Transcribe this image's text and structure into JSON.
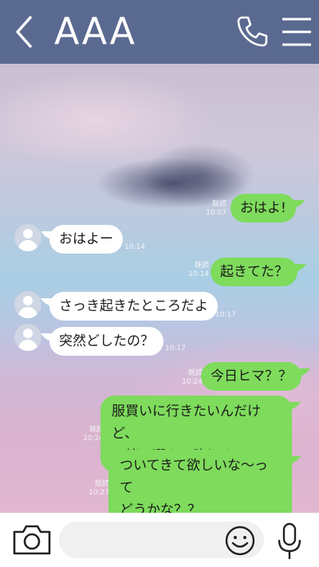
{
  "header": {
    "title": "AAA",
    "back_icon": "chevron-left-icon",
    "call_icon": "phone-icon",
    "menu_icon": "hamburger-menu-icon",
    "background": "#5a6990"
  },
  "messages": [
    {
      "side": "out",
      "text": "おはよ!",
      "read": "既読",
      "time": "10:07"
    },
    {
      "side": "in",
      "text": "おはよー",
      "time": "10:14"
    },
    {
      "side": "out",
      "text": "起きてた？",
      "read": "既読",
      "time": "10:14"
    },
    {
      "side": "in",
      "text": "さっき起きたところだよ",
      "time": "10:17"
    },
    {
      "side": "in",
      "text": "突然どしたの？",
      "time": "10:17"
    },
    {
      "side": "out",
      "text": "今日ヒマ？？",
      "read": "既読",
      "time": "10:24"
    },
    {
      "side": "out",
      "lines": [
        "服買いに行きたいんだけど、",
        "一緒に選んで欲しくて"
      ],
      "read": "既読",
      "time": "10:24"
    },
    {
      "side": "out",
      "lines": [
        "ついてきて欲しいな〜って",
        "どうかな？？"
      ],
      "read": "既読",
      "time": "10:27"
    }
  ],
  "footer": {
    "camera_icon": "camera-icon",
    "message_input_placeholder": "",
    "emoji_icon": "emoji-smile-icon",
    "mic_icon": "microphone-icon"
  },
  "colors": {
    "outgoing_bubble": "#7edb5c",
    "incoming_bubble": "#ffffff"
  }
}
